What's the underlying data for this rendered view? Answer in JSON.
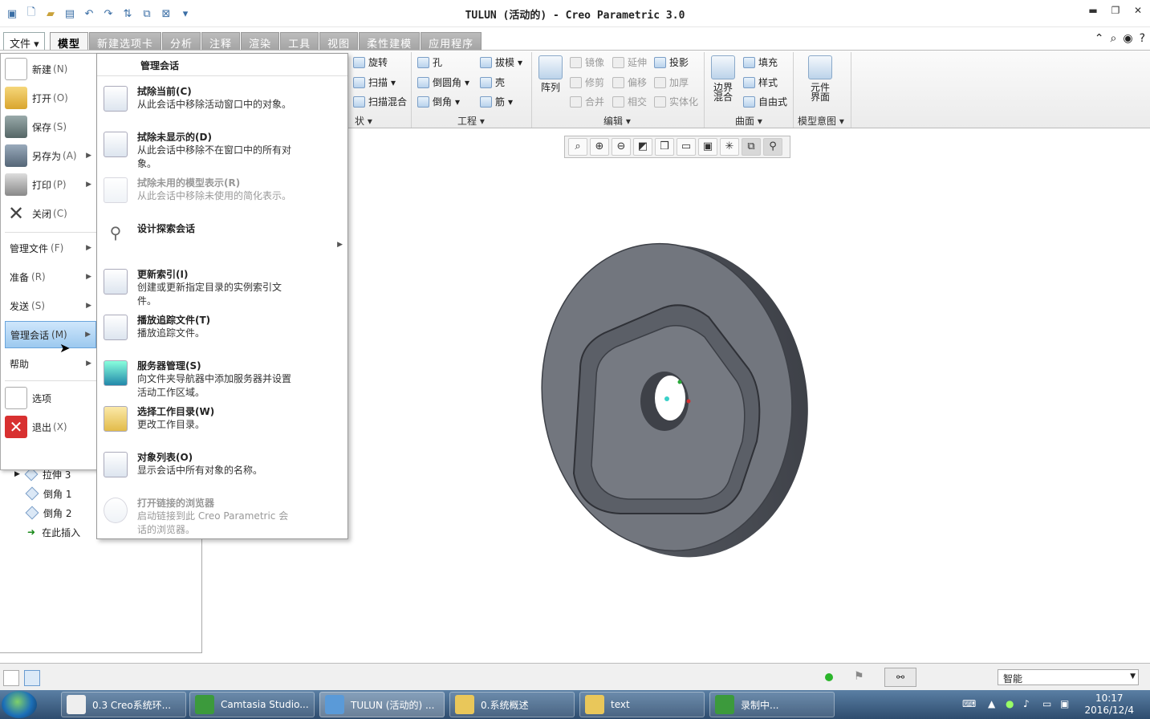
{
  "window": {
    "title": "TULUN (活动的) - Creo Parametric 3.0"
  },
  "tabs": {
    "file": "文件",
    "items": [
      "模型",
      "新建选项卡",
      "分析",
      "注释",
      "渲染",
      "工具",
      "视图",
      "柔性建模",
      "应用程序"
    ]
  },
  "ribbon": {
    "shape_group": {
      "revolve": "旋转",
      "sweep": "扫描",
      "swept_blend": "扫描混合",
      "label": "状"
    },
    "eng_group": {
      "hole": "孔",
      "round": "倒圆角",
      "chamfer": "倒角",
      "draft": "拔模",
      "shell": "壳",
      "rib": "筋",
      "label": "工程"
    },
    "edit_group": {
      "pattern": "阵列",
      "mirror": "镜像",
      "trim": "修剪",
      "merge": "合并",
      "extend": "延伸",
      "offset": "偏移",
      "intersect": "相交",
      "project": "投影",
      "thicken": "加厚",
      "solidify": "实体化",
      "label": "编辑"
    },
    "surface_group": {
      "boundary": "边界混合",
      "fill": "填充",
      "style": "样式",
      "freestyle": "自由式",
      "label": "曲面"
    },
    "intent_group": {
      "component": "元件界面",
      "label": "模型意图"
    }
  },
  "file_menu": {
    "items": [
      {
        "label": "新建",
        "key": "(N)"
      },
      {
        "label": "打开",
        "key": "(O)"
      },
      {
        "label": "保存",
        "key": "(S)"
      },
      {
        "label": "另存为",
        "key": "(A)"
      },
      {
        "label": "打印",
        "key": "(P)"
      },
      {
        "label": "关闭",
        "key": "(C)"
      }
    ],
    "sections": [
      {
        "label": "管理文件",
        "key": "(F)"
      },
      {
        "label": "准备",
        "key": "(R)"
      },
      {
        "label": "发送",
        "key": "(S)"
      },
      {
        "label": "管理会话",
        "key": "(M)"
      },
      {
        "label": "帮助",
        "key": ""
      }
    ],
    "options": "选项",
    "exit": {
      "label": "退出",
      "key": "(X)"
    }
  },
  "submenu": {
    "title": "管理会话",
    "items": [
      {
        "title": "拭除当前(C)",
        "desc": "从此会话中移除活动窗口中的对象。"
      },
      {
        "title": "拭除未显示的(D)",
        "desc": "从此会话中移除不在窗口中的所有对象。"
      },
      {
        "title": "拭除未用的模型表示(R)",
        "desc": "从此会话中移除未使用的简化表示。"
      },
      {
        "title": "设计探索会话",
        "desc": ""
      },
      {
        "title": "更新索引(I)",
        "desc": "创建或更新指定目录的实例索引文件。"
      },
      {
        "title": "播放追踪文件(T)",
        "desc": "播放追踪文件。"
      },
      {
        "title": "服务器管理(S)",
        "desc": "向文件夹导航器中添加服务器并设置活动工作区域。"
      },
      {
        "title": "选择工作目录(W)",
        "desc": "更改工作目录。"
      },
      {
        "title": "对象列表(O)",
        "desc": "显示会话中所有对象的名称。"
      },
      {
        "title": "打开链接的浏览器",
        "desc": "启动链接到此 Creo Parametric 会话的浏览器。"
      }
    ]
  },
  "tree": {
    "items": [
      "拉伸 3",
      "倒角 1",
      "倒角 2",
      "在此插入"
    ]
  },
  "status": {
    "filter": "智能"
  },
  "taskbar": {
    "items": [
      "0.3 Creo系统环...",
      "Camtasia Studio...",
      "TULUN (活动的) ...",
      "0.系统概述",
      "text",
      "录制中..."
    ],
    "time": "10:17",
    "date": "2016/12/4"
  }
}
